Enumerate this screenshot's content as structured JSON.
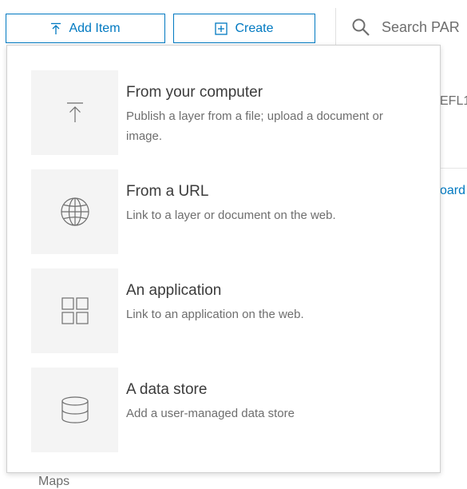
{
  "toolbar": {
    "add_item_label": "Add Item",
    "create_label": "Create"
  },
  "search": {
    "placeholder": "Search PAR"
  },
  "background": {
    "partial_text_1": "EFL1(",
    "partial_link_2": "oard",
    "partial_text_3": "Maps"
  },
  "add_item_menu": {
    "options": [
      {
        "title": "From your computer",
        "description": "Publish a layer from a file; upload a document or image.",
        "icon": "upload-icon"
      },
      {
        "title": "From a URL",
        "description": "Link to a layer or document on the web.",
        "icon": "globe-icon"
      },
      {
        "title": "An application",
        "description": "Link to an application on the web.",
        "icon": "grid-icon"
      },
      {
        "title": "A data store",
        "description": "Add a user-managed data store",
        "icon": "database-icon"
      }
    ]
  },
  "colors": {
    "accent": "#0079c1",
    "tile_background": "#f4f4f4",
    "text_primary": "#3b3b3b",
    "text_secondary": "#6e6e6e"
  }
}
